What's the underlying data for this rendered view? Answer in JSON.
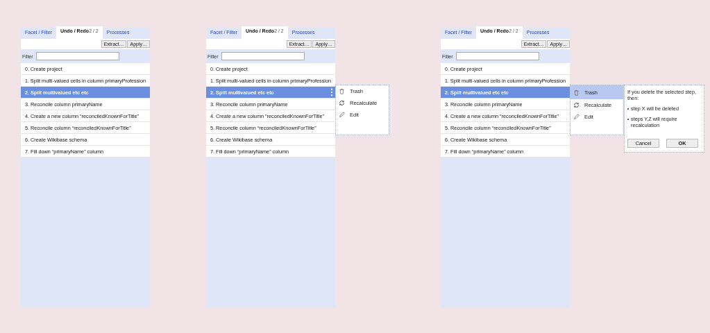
{
  "panels": [
    {
      "tabs": [
        {
          "label": "Facet / Filter",
          "selected": false
        },
        {
          "label": "Undo / Redo",
          "count": "2 / 2",
          "selected": true
        },
        {
          "label": "Processes",
          "selected": false
        }
      ],
      "toolbar_buttons": [
        "Extract…",
        "Apply…"
      ],
      "filter": {
        "label": "Filter"
      },
      "steps": [
        {
          "number": "0.",
          "label": "Create project",
          "selected": false
        },
        {
          "number": "1.",
          "label": "Split multi-valued cells in column primaryProfession",
          "selected": false
        },
        {
          "number": "2.",
          "label": "Split multivalued etc etc",
          "selected": true
        },
        {
          "number": "3.",
          "label": "Reconcile column primaryName",
          "selected": false
        },
        {
          "number": "4.",
          "label": "Create a new column “reconciledKnownForTitle”",
          "selected": false
        },
        {
          "number": "5.",
          "label": "Reconcile column “reconciledKnownForTitle”",
          "selected": false
        },
        {
          "number": "6.",
          "label": "Create Wikibase schema",
          "selected": false
        },
        {
          "number": "7.",
          "label": "Fill down “primaryName” column",
          "selected": false
        }
      ]
    },
    {
      "tabs": [
        {
          "label": "Facet / Filter",
          "selected": false
        },
        {
          "label": "Undo / Redo",
          "count": "2 / 2",
          "selected": true
        },
        {
          "label": "Processes",
          "selected": false
        }
      ],
      "toolbar_buttons": [
        "Extract…",
        "Apply…"
      ],
      "filter": {
        "label": "Filter"
      },
      "steps": [
        {
          "number": "0.",
          "label": "Create project",
          "selected": false
        },
        {
          "number": "1.",
          "label": "Split multi-valued cells in column primaryProfession",
          "selected": false
        },
        {
          "number": "2.",
          "label": "Split multivalued etc etc",
          "selected": true,
          "actions_button": true
        },
        {
          "number": "3.",
          "label": "Reconcile column primaryName",
          "selected": false
        },
        {
          "number": "4.",
          "label": "Create a new column “reconciledKnownForTitle”",
          "selected": false
        },
        {
          "number": "5.",
          "label": "Reconcile column “reconciledKnownForTitle”",
          "selected": false
        },
        {
          "number": "6.",
          "label": "Create Wikibase schema",
          "selected": false
        },
        {
          "number": "7.",
          "label": "Fill down “primaryName” column",
          "selected": false
        }
      ],
      "step_menu": [
        {
          "kind": "trash",
          "label": "Trash",
          "selected": false
        },
        {
          "kind": "recalculate",
          "label": "Recalculate",
          "selected": false
        },
        {
          "kind": "edit",
          "label": "Edit",
          "selected": false
        }
      ]
    },
    {
      "tabs": [
        {
          "label": "Facet / Filter",
          "selected": false
        },
        {
          "label": "Undo / Redo",
          "count": "2 / 2",
          "selected": true
        },
        {
          "label": "Processes",
          "selected": false
        }
      ],
      "toolbar_buttons": [
        "Extract…",
        "Apply…"
      ],
      "filter": {
        "label": "Filter"
      },
      "steps": [
        {
          "number": "0.",
          "label": "Create project",
          "selected": false
        },
        {
          "number": "1.",
          "label": "Split multi-valued cells in column primaryProfession",
          "selected": false
        },
        {
          "number": "2.",
          "label": "Split multivalued etc etc",
          "selected": true
        },
        {
          "number": "3.",
          "label": "Reconcile column primaryName",
          "selected": false
        },
        {
          "number": "4.",
          "label": "Create a new column “reconciledKnownForTitle”",
          "selected": false
        },
        {
          "number": "5.",
          "label": "Reconcile column “reconciledKnownForTitle”",
          "selected": false
        },
        {
          "number": "6.",
          "label": "Create Wikibase schema",
          "selected": false
        },
        {
          "number": "7.",
          "label": "Fill down “primaryName” column",
          "selected": false
        }
      ],
      "step_menu": [
        {
          "kind": "trash",
          "label": "Trash",
          "selected": true
        },
        {
          "kind": "recalculate",
          "label": "Recalculate",
          "selected": false
        },
        {
          "kind": "edit",
          "label": "Edit",
          "selected": false
        }
      ],
      "confirm": {
        "message": "If you delete the selected step, then:",
        "bullets": [
          "step X will be deleted",
          "steps Y,Z will require recalculation"
        ],
        "buttons": [
          "Cancel",
          "OK"
        ]
      }
    }
  ]
}
